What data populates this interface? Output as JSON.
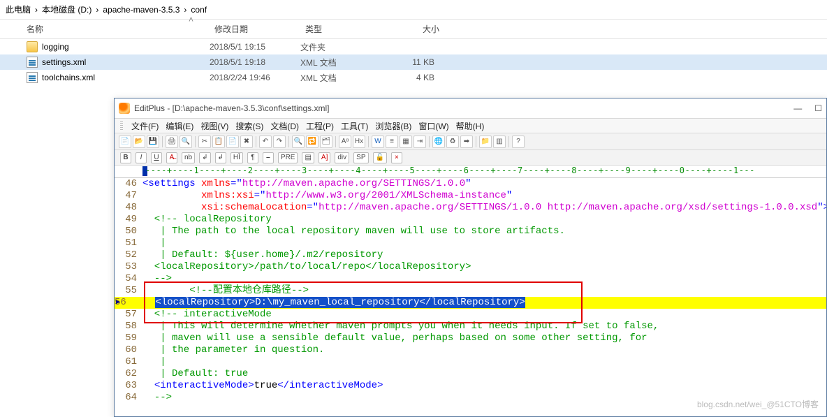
{
  "breadcrumb": {
    "seg0": "此电脑",
    "seg1": "本地磁盘 (D:)",
    "seg2": "apache-maven-3.5.3",
    "seg3": "conf"
  },
  "explorer": {
    "head_name": "名称",
    "head_date": "修改日期",
    "head_type": "类型",
    "head_size": "大小",
    "rows": [
      {
        "name": "logging",
        "date": "2018/5/1 19:15",
        "type": "文件夹",
        "size": ""
      },
      {
        "name": "settings.xml",
        "date": "2018/5/1 19:18",
        "type": "XML 文档",
        "size": "11 KB"
      },
      {
        "name": "toolchains.xml",
        "date": "2018/2/24 19:46",
        "type": "XML 文档",
        "size": "4 KB"
      }
    ]
  },
  "ep": {
    "title": "EditPlus - [D:\\apache-maven-3.5.3\\conf\\settings.xml]",
    "menu": [
      "文件(F)",
      "编辑(E)",
      "视图(V)",
      "搜索(S)",
      "文档(D)",
      "工程(P)",
      "工具(T)",
      "浏览器(B)",
      "窗口(W)",
      "帮助(H)"
    ],
    "tb2": [
      "B",
      "I",
      "U",
      "A̶",
      "nb",
      "↲",
      "↲",
      "HĪ",
      "¶",
      "⎯",
      "PRE",
      "▤",
      "A]",
      "div",
      "SP",
      "🔓",
      "×"
    ],
    "ruler": "----+----1----+----2----+----3----+----4----+----5----+----6----+----7----+----8----+----9----+----0----+----1---"
  },
  "code": {
    "l46_a": "<settings ",
    "l46_b": "xmlns",
    "l46_c": "=\"",
    "l46_d": "http://maven.apache.org/SETTINGS/1.0.0",
    "l46_e": "\"",
    "l47_a": "          ",
    "l47_b": "xmlns:xsi",
    "l47_c": "=\"",
    "l47_d": "http://www.w3.org/2001/XMLSchema-instance",
    "l47_e": "\"",
    "l48_a": "          ",
    "l48_b": "xsi:schemaLocation",
    "l48_c": "=\"",
    "l48_d": "http://maven.apache.org/SETTINGS/1.0.0 http://maven.apache.org/xsd/settings-1.0.0.xsd",
    "l48_e": "\">",
    "l49": "  <!-- localRepository",
    "l50": "   | The path to the local repository maven will use to store artifacts.",
    "l51": "   |",
    "l52": "   | Default: ${user.home}/.m2/repository",
    "l53": "  <localRepository>/path/to/local/repo</localRepository>",
    "l54": "  -->",
    "l55": "        <!--配置本地仓库路径-->",
    "l56_a": "    ",
    "l56_b": "<localRepository>",
    "l56_c": "D:\\my_maven_local_repository",
    "l56_d": "</localRepository>",
    "l57": "  <!-- interactiveMode",
    "l58": "   | This will determine whether maven prompts you when it needs input. If set to false,",
    "l59": "   | maven will use a sensible default value, perhaps based on some other setting, for",
    "l60": "   | the parameter in question.",
    "l61": "   |",
    "l62": "   | Default: true",
    "l63_a": "  ",
    "l63_b": "<interactiveMode>",
    "l63_c": "true",
    "l63_d": "</interactiveMode>",
    "l64": "  -->"
  },
  "watermark": "blog.csdn.net/wei_@51CTO博客"
}
